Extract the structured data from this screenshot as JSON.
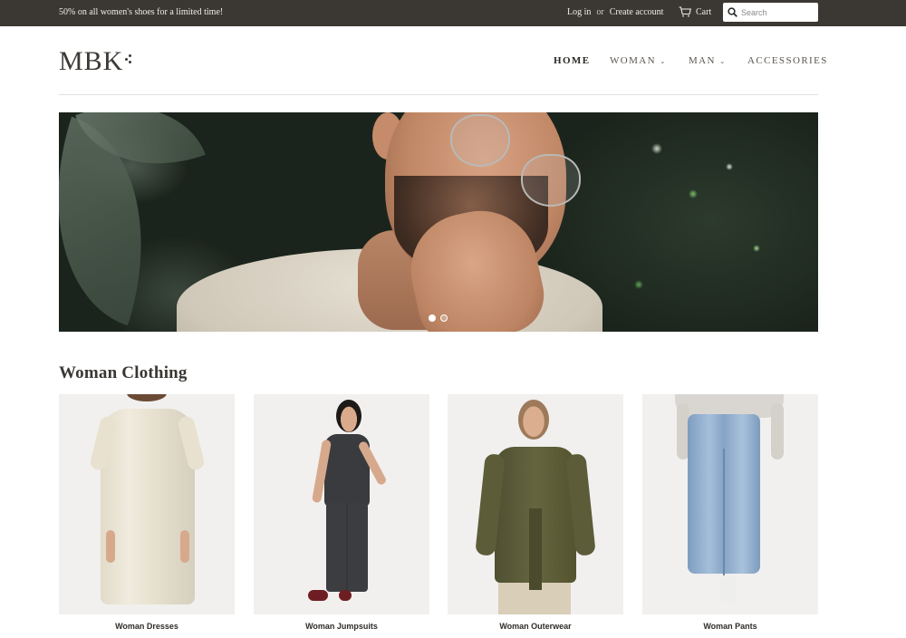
{
  "announcement": {
    "text": "50% on all women's shoes for a limited time!"
  },
  "account": {
    "login": "Log in",
    "or": "or",
    "create": "Create account"
  },
  "cart": {
    "label": "Cart"
  },
  "search": {
    "placeholder": "Search"
  },
  "brand": {
    "logo_text": "MBK"
  },
  "nav": {
    "items": [
      {
        "label": "HOME",
        "active": true,
        "dropdown": false
      },
      {
        "label": "WOMAN",
        "active": false,
        "dropdown": true
      },
      {
        "label": "MAN",
        "active": false,
        "dropdown": true
      },
      {
        "label": "ACCESSORIES",
        "active": false,
        "dropdown": false
      }
    ],
    "chevron": "⌄"
  },
  "slideshow": {
    "slides": 2,
    "current": 1
  },
  "section": {
    "title": "Woman Clothing",
    "collections": [
      {
        "label": "Woman Dresses",
        "icon": "dress-photo",
        "color": "#e9e3d3"
      },
      {
        "label": "Woman Jumpsuits",
        "icon": "jumpsuit-photo",
        "color": "#3d3f42"
      },
      {
        "label": "Woman Outerwear",
        "icon": "outerwear-photo",
        "color": "#5a5a3a"
      },
      {
        "label": "Woman Pants",
        "icon": "pants-photo",
        "color": "#8fa9c8"
      }
    ]
  },
  "colors": {
    "topbar": "#3b3833",
    "text": "#333333",
    "accent": "#2b2926"
  }
}
